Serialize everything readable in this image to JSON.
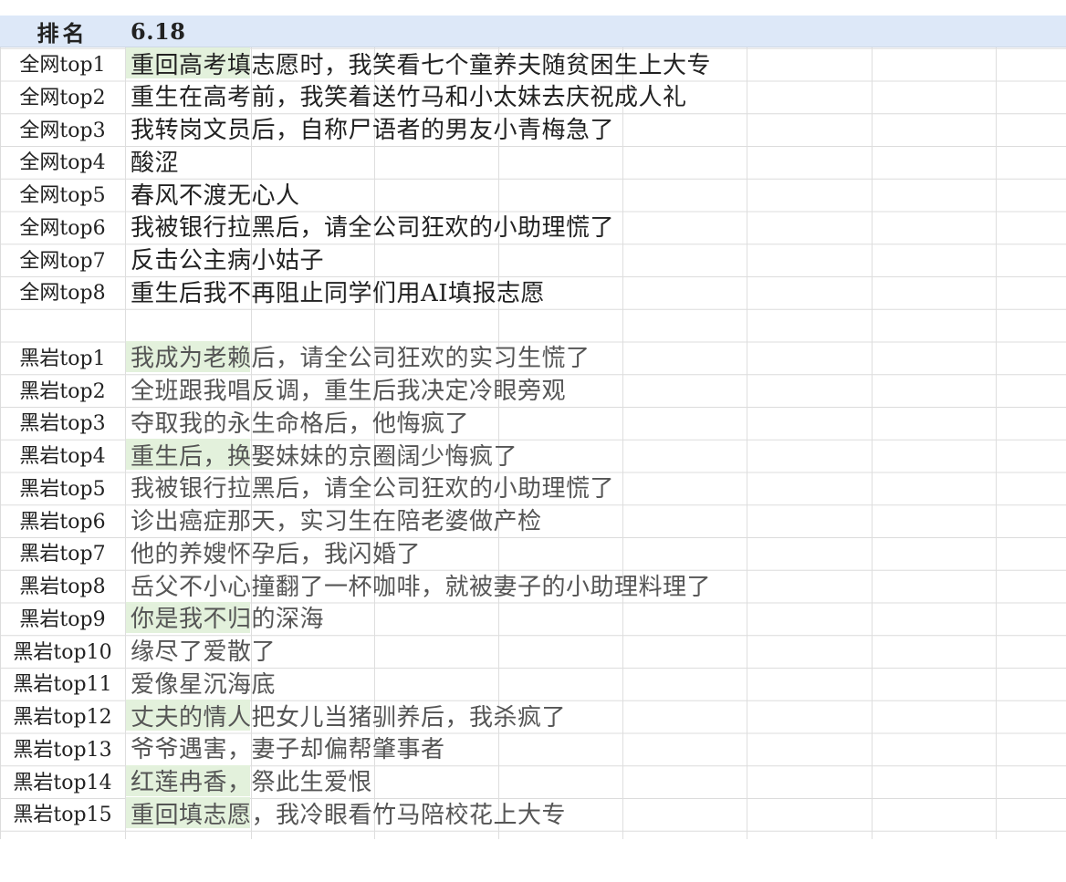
{
  "header": {
    "rank_label": "排名",
    "date_label": "6.18"
  },
  "quanwang": [
    {
      "rank": "全网top1",
      "title": "重回高考填志愿时，我笑看七个童养夫随贫困生上大专",
      "highlight": true
    },
    {
      "rank": "全网top2",
      "title": "重生在高考前，我笑着送竹马和小太妹去庆祝成人礼",
      "highlight": false
    },
    {
      "rank": "全网top3",
      "title": "我转岗文员后，自称尸语者的男友小青梅急了",
      "highlight": false
    },
    {
      "rank": "全网top4",
      "title": "酸涩",
      "highlight": false
    },
    {
      "rank": "全网top5",
      "title": "春风不渡无心人",
      "highlight": false
    },
    {
      "rank": "全网top6",
      "title": "我被银行拉黑后，请全公司狂欢的小助理慌了",
      "highlight": false
    },
    {
      "rank": "全网top7",
      "title": "反击公主病小姑子",
      "highlight": false
    },
    {
      "rank": "全网top8",
      "title": "重生后我不再阻止同学们用AI填报志愿",
      "highlight": false
    }
  ],
  "heiyan": [
    {
      "rank": "黑岩top1",
      "title": "我成为老赖后，请全公司狂欢的实习生慌了",
      "highlight": true
    },
    {
      "rank": "黑岩top2",
      "title": "全班跟我唱反调，重生后我决定冷眼旁观",
      "highlight": false
    },
    {
      "rank": "黑岩top3",
      "title": "夺取我的永生命格后，他悔疯了",
      "highlight": false
    },
    {
      "rank": "黑岩top4",
      "title": "重生后，换娶妹妹的京圈阔少悔疯了",
      "highlight": true
    },
    {
      "rank": "黑岩top5",
      "title": "我被银行拉黑后，请全公司狂欢的小助理慌了",
      "highlight": false
    },
    {
      "rank": "黑岩top6",
      "title": "诊出癌症那天，实习生在陪老婆做产检",
      "highlight": false
    },
    {
      "rank": "黑岩top7",
      "title": "他的养嫂怀孕后，我闪婚了",
      "highlight": false
    },
    {
      "rank": "黑岩top8",
      "title": "岳父不小心撞翻了一杯咖啡，就被妻子的小助理料理了",
      "highlight": false
    },
    {
      "rank": "黑岩top9",
      "title": "你是我不归的深海",
      "highlight": true
    },
    {
      "rank": "黑岩top10",
      "title": "缘尽了爱散了",
      "highlight": false
    },
    {
      "rank": "黑岩top11",
      "title": "爱像星沉海底",
      "highlight": false
    },
    {
      "rank": "黑岩top12",
      "title": "丈夫的情人把女儿当猪驯养后，我杀疯了",
      "highlight": true
    },
    {
      "rank": "黑岩top13",
      "title": "爷爷遇害，妻子却偏帮肇事者",
      "highlight": false
    },
    {
      "rank": "黑岩top14",
      "title": "红莲冉香，祭此生爱恨",
      "highlight": true
    },
    {
      "rank": "黑岩top15",
      "title": "重回填志愿，我冷眼看竹马陪校花上大专",
      "highlight": true
    }
  ],
  "colors": {
    "header_bg": "#dde8f8",
    "highlight_bg": "#e3f1dc",
    "grid": "#dcdcdc"
  }
}
